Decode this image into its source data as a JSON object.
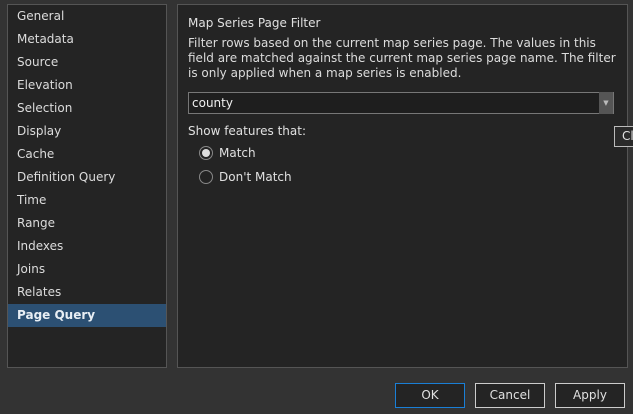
{
  "sidebar": {
    "items": [
      {
        "label": "General"
      },
      {
        "label": "Metadata"
      },
      {
        "label": "Source"
      },
      {
        "label": "Elevation"
      },
      {
        "label": "Selection"
      },
      {
        "label": "Display"
      },
      {
        "label": "Cache"
      },
      {
        "label": "Definition Query"
      },
      {
        "label": "Time"
      },
      {
        "label": "Range"
      },
      {
        "label": "Indexes"
      },
      {
        "label": "Joins"
      },
      {
        "label": "Relates"
      },
      {
        "label": "Page Query",
        "selected": true
      }
    ]
  },
  "main": {
    "title": "Map Series Page Filter",
    "description": "Filter rows based on the current map series page. The values in this field are matched against the current map series page name. The filter is only applied when a map series is enabled.",
    "field_value": "county",
    "show_label": "Show features that:",
    "options": [
      {
        "label": "Match",
        "checked": true
      },
      {
        "label": "Don't Match",
        "checked": false
      }
    ]
  },
  "tooltip": "Cl",
  "buttons": {
    "ok": "OK",
    "cancel": "Cancel",
    "apply": "Apply"
  }
}
